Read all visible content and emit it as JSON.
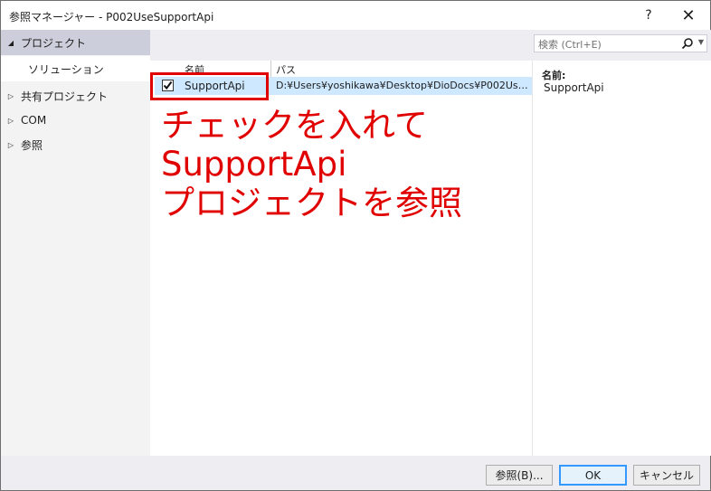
{
  "window": {
    "title": "参照マネージャー - P002UseSupportApi",
    "help_label": "?",
    "close_label": "✕"
  },
  "nav": {
    "project": {
      "arrow": "◢",
      "label": "プロジェクト"
    },
    "solution": {
      "label": "ソリューション"
    },
    "shared": {
      "arrow": "▷",
      "label": "共有プロジェクト"
    },
    "com": {
      "arrow": "▷",
      "label": "COM"
    },
    "browse": {
      "arrow": "▷",
      "label": "参照"
    }
  },
  "search": {
    "placeholder": "検索 (Ctrl+E)",
    "icon": "search-icon"
  },
  "list": {
    "columns": {
      "name": "名前",
      "path": "パス"
    },
    "rows": [
      {
        "checked": true,
        "name": "SupportApi",
        "path": "D:¥Users¥yoshikawa¥Desktop¥DioDocs¥P002UseSu..."
      }
    ]
  },
  "details": {
    "name_label": "名前:",
    "name_value": "SupportApi"
  },
  "annotation": {
    "line1": "チェックを入れて",
    "line2": "SupportApi",
    "line3": "プロジェクトを参照",
    "color": "#e00000"
  },
  "buttons": {
    "browse": "参照(B)...",
    "ok": "OK",
    "cancel": "キャンセル"
  },
  "colors": {
    "selected_nav": "#cccedb",
    "selected_row": "#cde8ff",
    "ok_border": "#3399ff"
  }
}
